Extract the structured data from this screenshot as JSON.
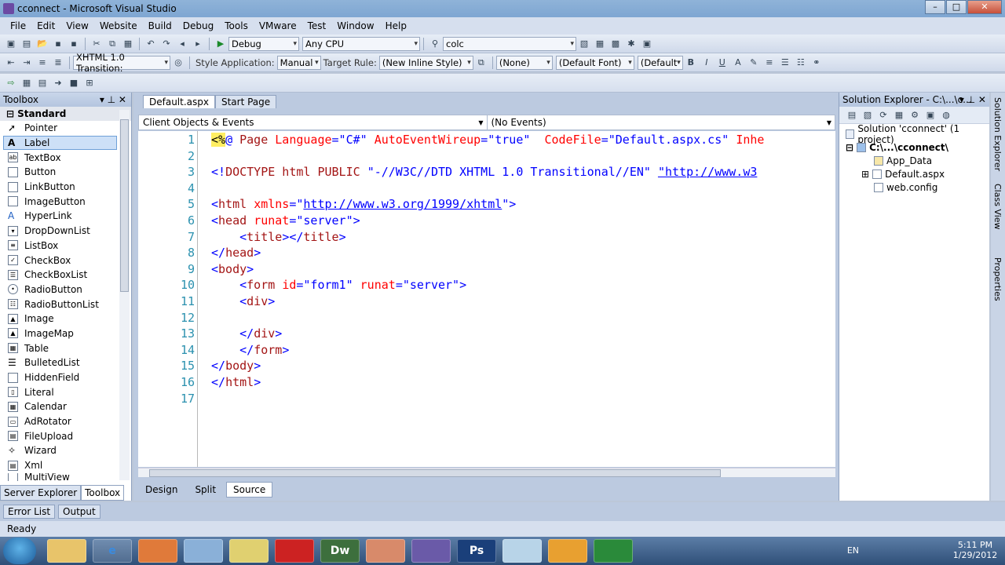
{
  "window": {
    "title": "cconnect - Microsoft Visual Studio",
    "minimize": "–",
    "maximize": "□",
    "close": "✕"
  },
  "menu": [
    "File",
    "Edit",
    "View",
    "Website",
    "Build",
    "Debug",
    "Tools",
    "VMware",
    "Test",
    "Window",
    "Help"
  ],
  "toolbar1": {
    "config": "Debug",
    "platform": "Any CPU",
    "find": "colc"
  },
  "toolbar2": {
    "doctype": "XHTML 1.0 Transition:",
    "style_app_label": "Style Application:",
    "style_app_value": "Manual",
    "target_rule_label": "Target Rule:",
    "target_rule_value": "(New Inline Style)",
    "style_none": "(None)",
    "font": "(Default Font)",
    "size": "(Default",
    "bold": "B",
    "italic": "I",
    "underline": "U"
  },
  "toolbox": {
    "title": "Toolbox",
    "group": "Standard",
    "items": [
      "Pointer",
      "Label",
      "TextBox",
      "Button",
      "LinkButton",
      "ImageButton",
      "HyperLink",
      "DropDownList",
      "ListBox",
      "CheckBox",
      "CheckBoxList",
      "RadioButton",
      "RadioButtonList",
      "Image",
      "ImageMap",
      "Table",
      "BulletedList",
      "HiddenField",
      "Literal",
      "Calendar",
      "AdRotator",
      "FileUpload",
      "Wizard",
      "Xml",
      "MultiView"
    ],
    "tabs": [
      "Server Explorer",
      "Toolbox"
    ]
  },
  "editor": {
    "tabs": [
      "Default.aspx",
      "Start Page"
    ],
    "nav_left": "Client Objects & Events",
    "nav_right": "(No Events)",
    "line_numbers": [
      "1",
      "2",
      "3",
      "4",
      "5",
      "6",
      "7",
      "8",
      "9",
      "10",
      "11",
      "12",
      "13",
      "14",
      "15",
      "16",
      "17"
    ],
    "view_tabs": [
      "Design",
      "Split",
      "Source"
    ]
  },
  "solution_explorer": {
    "title": "Solution Explorer - C:\\...\\c...",
    "solution": "Solution 'cconnect' (1 project)",
    "project": "C:\\...\\cconnect\\",
    "items": [
      "App_Data",
      "Default.aspx",
      "web.config"
    ]
  },
  "side_tabs": [
    "Solution Explorer",
    "Class View",
    "Properties"
  ],
  "bottom_tabs": [
    "Error List",
    "Output"
  ],
  "status": "Ready",
  "taskbar": {
    "lang": "EN",
    "time": "5:11 PM",
    "date": "1/29/2012",
    "apps": [
      "Dw",
      "Ps"
    ]
  }
}
